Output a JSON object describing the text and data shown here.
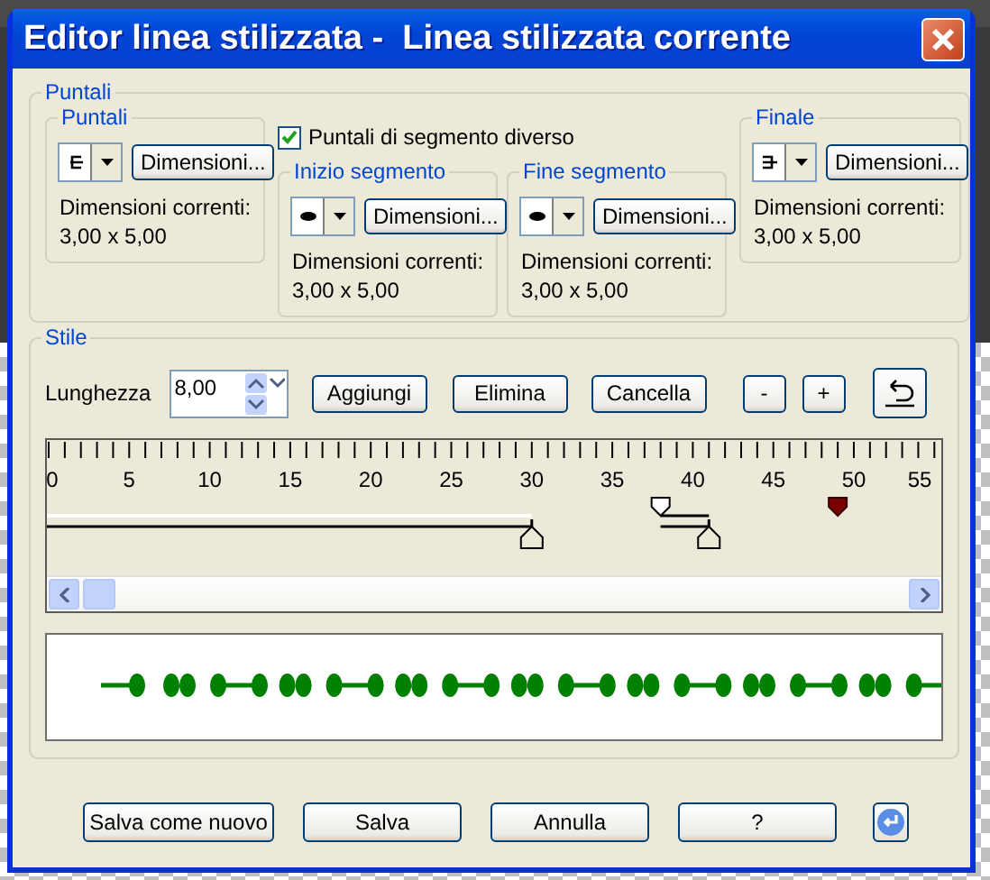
{
  "window": {
    "title": "Editor linea stilizzata -  Linea stilizzata corrente"
  },
  "tips_group": {
    "legend": "Puntali",
    "start": {
      "legend": "Puntali",
      "button": "Dimensioni...",
      "current_label": "Dimensioni correnti:",
      "current_value": "3,00 x 5,00"
    },
    "different_segment": {
      "label": "Puntali di segmento diverso",
      "checked": true
    },
    "segment_start": {
      "legend": "Inizio segmento",
      "button": "Dimensioni...",
      "current_label": "Dimensioni correnti:",
      "current_value": "3,00 x 5,00"
    },
    "segment_end": {
      "legend": "Fine segmento",
      "button": "Dimensioni...",
      "current_label": "Dimensioni correnti:",
      "current_value": "3,00 x 5,00"
    },
    "end": {
      "legend": "Finale",
      "button": "Dimensioni...",
      "current_label": "Dimensioni correnti:",
      "current_value": "3,00 x 5,00"
    }
  },
  "style_group": {
    "legend": "Stile",
    "length_label": "Lunghezza",
    "length_value": "8,00",
    "buttons": [
      "Aggiungi",
      "Elimina",
      "Cancella",
      "-",
      "+"
    ],
    "ruler_labels": [
      "0",
      "5",
      "10",
      "15",
      "20",
      "25",
      "30",
      "35",
      "40",
      "45",
      "50",
      "55"
    ]
  },
  "buttons": [
    "Salva come nuovo",
    "Salva",
    "Annulla",
    "?"
  ]
}
